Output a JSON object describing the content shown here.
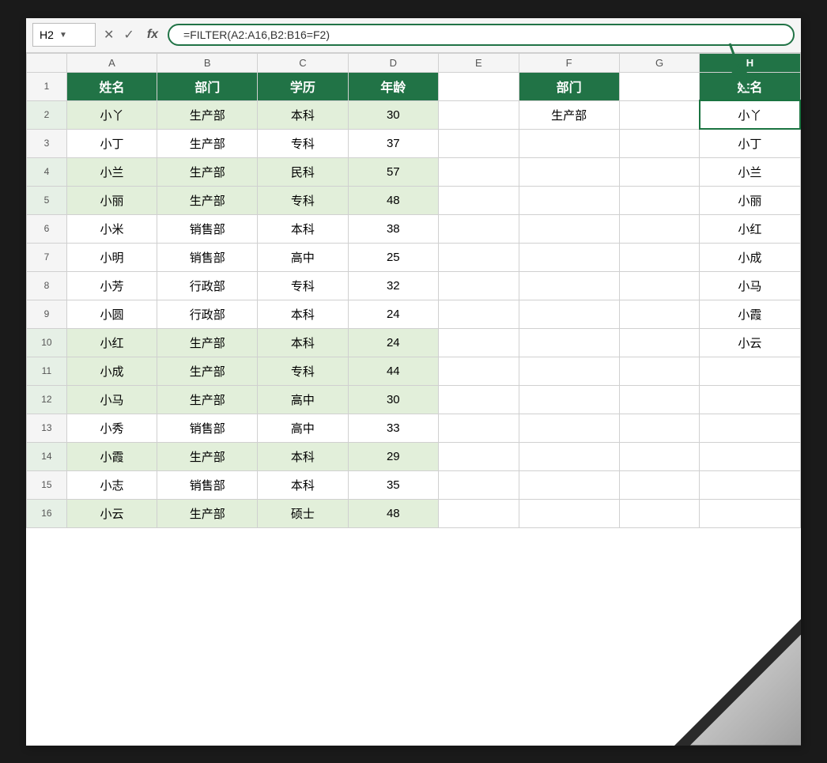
{
  "formula_bar": {
    "cell_ref": "H2",
    "formula": "=FILTER(A2:A16,B2:B16=F2)",
    "fx_label": "fx",
    "cancel_label": "✕",
    "confirm_label": "✓"
  },
  "columns": {
    "headers": [
      "",
      "A",
      "B",
      "C",
      "D",
      "E",
      "F",
      "G",
      "H"
    ],
    "labels": {
      "A": "A",
      "B": "B",
      "C": "C",
      "D": "D",
      "E": "E",
      "F": "F",
      "G": "G",
      "H": "H"
    }
  },
  "header_row": {
    "A": "姓名",
    "B": "部门",
    "C": "学历",
    "D": "年龄",
    "F": "部门",
    "H": "姓名"
  },
  "rows": [
    {
      "num": 2,
      "A": "小丫",
      "B": "生产部",
      "C": "本科",
      "D": "30",
      "F": "生产部",
      "H": "小丫",
      "highlight": true
    },
    {
      "num": 3,
      "A": "小丁",
      "B": "生产部",
      "C": "专科",
      "D": "37",
      "F": "",
      "H": "小丁",
      "highlight": false
    },
    {
      "num": 4,
      "A": "小兰",
      "B": "生产部",
      "C": "民科",
      "D": "57",
      "F": "",
      "H": "小兰",
      "highlight": true
    },
    {
      "num": 5,
      "A": "小丽",
      "B": "生产部",
      "C": "专科",
      "D": "48",
      "F": "",
      "H": "小丽",
      "highlight": true
    },
    {
      "num": 6,
      "A": "小米",
      "B": "销售部",
      "C": "本科",
      "D": "38",
      "F": "",
      "H": "小红",
      "highlight": false
    },
    {
      "num": 7,
      "A": "小明",
      "B": "销售部",
      "C": "高中",
      "D": "25",
      "F": "",
      "H": "小成",
      "highlight": false
    },
    {
      "num": 8,
      "A": "小芳",
      "B": "行政部",
      "C": "专科",
      "D": "32",
      "F": "",
      "H": "小马",
      "highlight": false
    },
    {
      "num": 9,
      "A": "小圆",
      "B": "行政部",
      "C": "本科",
      "D": "24",
      "F": "",
      "H": "小霞",
      "highlight": false
    },
    {
      "num": 10,
      "A": "小红",
      "B": "生产部",
      "C": "本科",
      "D": "24",
      "F": "",
      "H": "小云",
      "highlight": true
    },
    {
      "num": 11,
      "A": "小成",
      "B": "生产部",
      "C": "专科",
      "D": "44",
      "F": "",
      "H": "",
      "highlight": true
    },
    {
      "num": 12,
      "A": "小马",
      "B": "生产部",
      "C": "高中",
      "D": "30",
      "F": "",
      "H": "",
      "highlight": true
    },
    {
      "num": 13,
      "A": "小秀",
      "B": "销售部",
      "C": "高中",
      "D": "33",
      "F": "",
      "H": "",
      "highlight": false
    },
    {
      "num": 14,
      "A": "小霞",
      "B": "生产部",
      "C": "本科",
      "D": "29",
      "F": "",
      "H": "",
      "highlight": true
    },
    {
      "num": 15,
      "A": "小志",
      "B": "销售部",
      "C": "本科",
      "D": "35",
      "F": "",
      "H": "",
      "highlight": false
    },
    {
      "num": 16,
      "A": "小云",
      "B": "生产部",
      "C": "硕士",
      "D": "48",
      "F": "",
      "H": "",
      "highlight": true
    }
  ]
}
